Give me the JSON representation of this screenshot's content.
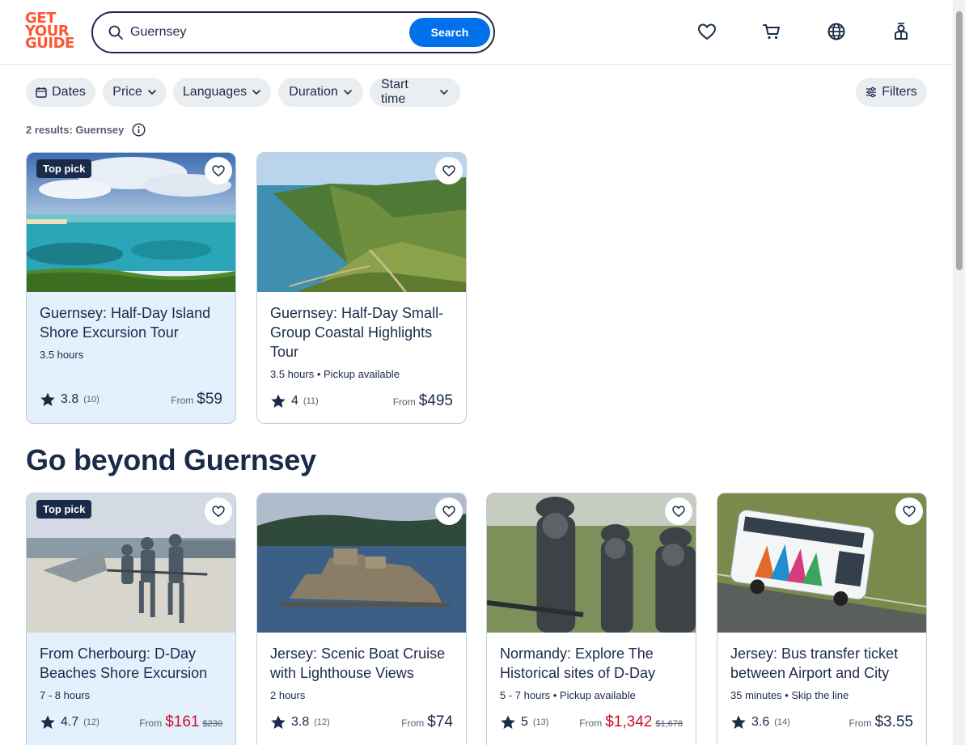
{
  "logo": {
    "line1": "GET",
    "line2": "YOUR",
    "line3": "GUIDE"
  },
  "search": {
    "value": "Guernsey",
    "button": "Search"
  },
  "header_icons": [
    "heart-icon",
    "cart-icon",
    "globe-icon",
    "profile-icon"
  ],
  "filters": {
    "dates": "Dates",
    "price": "Price",
    "languages": "Languages",
    "duration": "Duration",
    "start_time": "Start time",
    "more": "Filters"
  },
  "results_text": "2 results: Guernsey",
  "results": [
    {
      "badge": "Top pick",
      "title": "Guernsey: Half-Day Island Shore Excursion Tour",
      "meta": "3.5 hours",
      "rating": "3.8",
      "reviews": "(10)",
      "from": "From",
      "price": "$59",
      "old_price": ""
    },
    {
      "badge": "",
      "title": "Guernsey: Half-Day Small-Group Coastal Highlights Tour",
      "meta": "3.5 hours • Pickup available",
      "rating": "4",
      "reviews": "(11)",
      "from": "From",
      "price": "$495",
      "old_price": ""
    }
  ],
  "section_title": "Go beyond Guernsey",
  "beyond": [
    {
      "badge": "Top pick",
      "title": "From Cherbourg: D-Day Beaches Shore Excursion",
      "meta": "7 - 8 hours",
      "rating": "4.7",
      "reviews": "(12)",
      "from": "From",
      "price": "$161",
      "old_price": "$230"
    },
    {
      "badge": "",
      "title": "Jersey: Scenic Boat Cruise with Lighthouse Views",
      "meta": "2 hours",
      "rating": "3.8",
      "reviews": "(12)",
      "from": "From",
      "price": "$74",
      "old_price": ""
    },
    {
      "badge": "",
      "title": "Normandy: Explore The Historical sites of D-Day",
      "meta": "5 - 7 hours • Pickup available",
      "rating": "5",
      "reviews": "(13)",
      "from": "From",
      "price": "$1,342",
      "old_price": "$1,678"
    },
    {
      "badge": "",
      "title": "Jersey: Bus transfer ticket between Airport and City",
      "meta": "35 minutes • Skip the line",
      "rating": "3.6",
      "reviews": "(14)",
      "from": "From",
      "price": "$3.55",
      "old_price": ""
    }
  ],
  "colors": {
    "brand": "#ff5533",
    "primary": "#0071eb",
    "text": "#1a2b49",
    "sale": "#c8102e",
    "highlight": "#e5f0fd"
  }
}
